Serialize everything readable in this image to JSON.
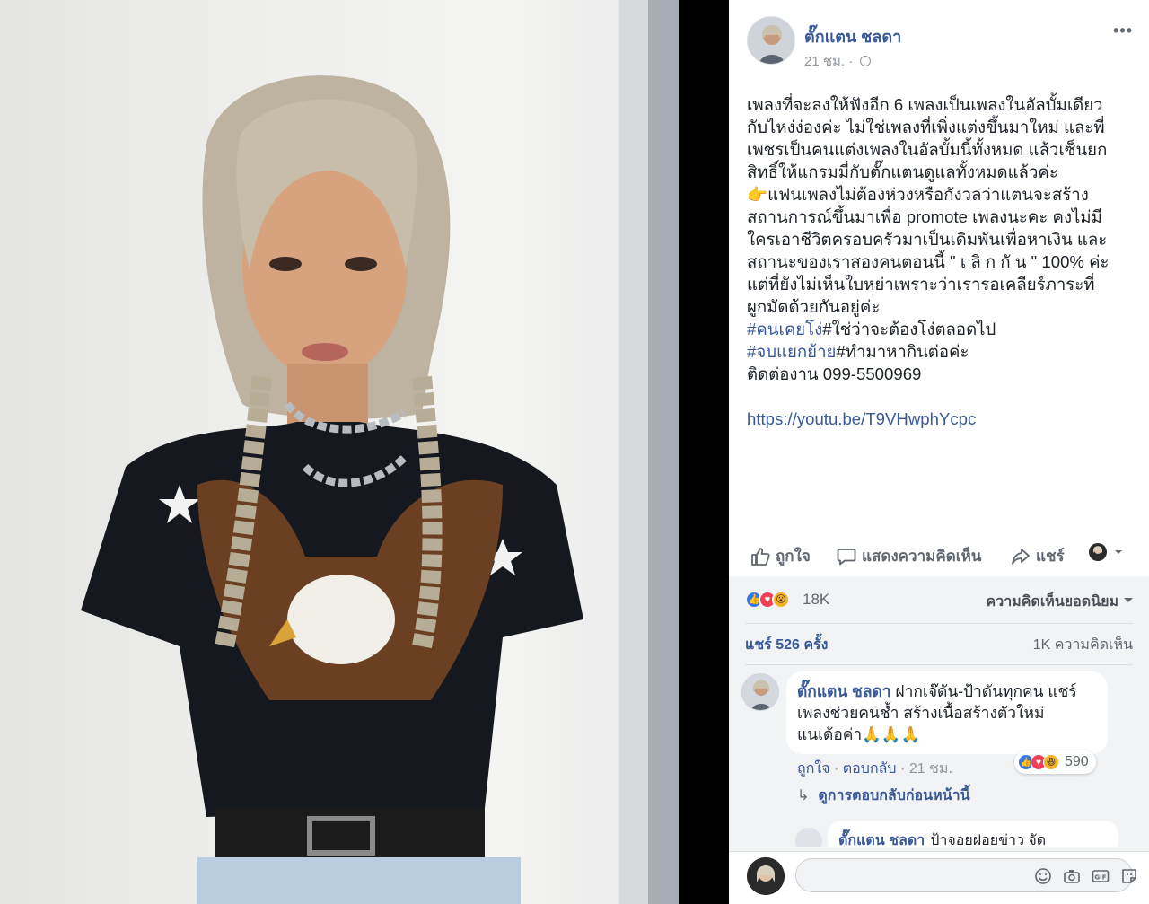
{
  "post": {
    "author": "ตั๊กแตน ชลดา",
    "time": "21 ชม. ·",
    "more_label": "•••",
    "body_lines": [
      "เพลงที่จะลงให้ฟังอีก 6 เพลงเป็นเพลงในอัลบั้มเดียว",
      "กับไหง่ง่องค่ะ ไม่ใช่เพลงที่เพิ่งแต่งขึ้นมาใหม่ และพี่",
      "เพชรเป็นคนแต่งเพลงในอัลบั้มนี้ทั้งหมด แล้วเซ็นยก",
      "สิทธิ์ให้แกรมมี่กับตั๊กแตนดูแลทั้งหมดแล้วค่ะ",
      "👉แฟนเพลงไม่ต้องห่วงหรือกังวลว่าแตนจะสร้าง",
      "สถานการณ์ขึ้นมาเพื่อ promote เพลงนะคะ คงไม่มี",
      "ใครเอาชีวิตครอบครัวมาเป็นเดิมพันเพื่อหาเงิน และ",
      "สถานะของเราสองคนตอนนี้ \" เ ลิ ก กั น \" 100% ค่ะ",
      "แต่ที่ยังไม่เห็นใบหย่าเพราะว่าเรารอเคลียร์ภาระที่",
      "ผูกมัดด้วยกันอยู่ค่ะ"
    ],
    "tag1": "#คนเคยโง่",
    "tag1_rest": "#ใช่ว่าจะต้องโง่ตลอดไป",
    "tag2": "#จบแยกย้าย",
    "tag2_rest": "#ทำมาหากินต่อค่ะ",
    "contact": "ติดต่องาน 099-5500969",
    "link": "https://youtu.be/T9VHwphYcpc"
  },
  "actions": {
    "like": "ถูกใจ",
    "comment": "แสดงความคิดเห็น",
    "share": "แชร์"
  },
  "stats": {
    "reaction_count": "18K",
    "sort_label": "ความคิดเห็นยอดนิยม",
    "shares": "แชร์ 526 ครั้ง",
    "comments": "1K ความคิดเห็น"
  },
  "comment": {
    "author": "ตั๊กแตน ชลดา",
    "text_line1": " ฝากเจ๊ดัน-ป้าดันทุกคน แชร์",
    "text_line2": "เพลงช่วยคนช้ำ สร้างเนื้อสร้างตัวใหม่",
    "text_line3": "แนเด้อค่า🙏🙏🙏",
    "reaction_count": "590",
    "like": "ถูกใจ",
    "reply": "ตอบกลับ",
    "time": "21 ชม."
  },
  "replies": {
    "label": "ดูการตอบกลับก่อนหน้านี้",
    "peek_author": "ตั๊กแตน ชลดา",
    "peek_text": "ป้าจอยฝอยข่าว จัด"
  },
  "composer": {
    "placeholder": ""
  },
  "colors": {
    "link_blue": "#385898",
    "like_blue": "#3578e5",
    "love_red": "#f33e58",
    "wow_yellow": "#f7b125",
    "panel_grey": "#f2f3f5"
  }
}
